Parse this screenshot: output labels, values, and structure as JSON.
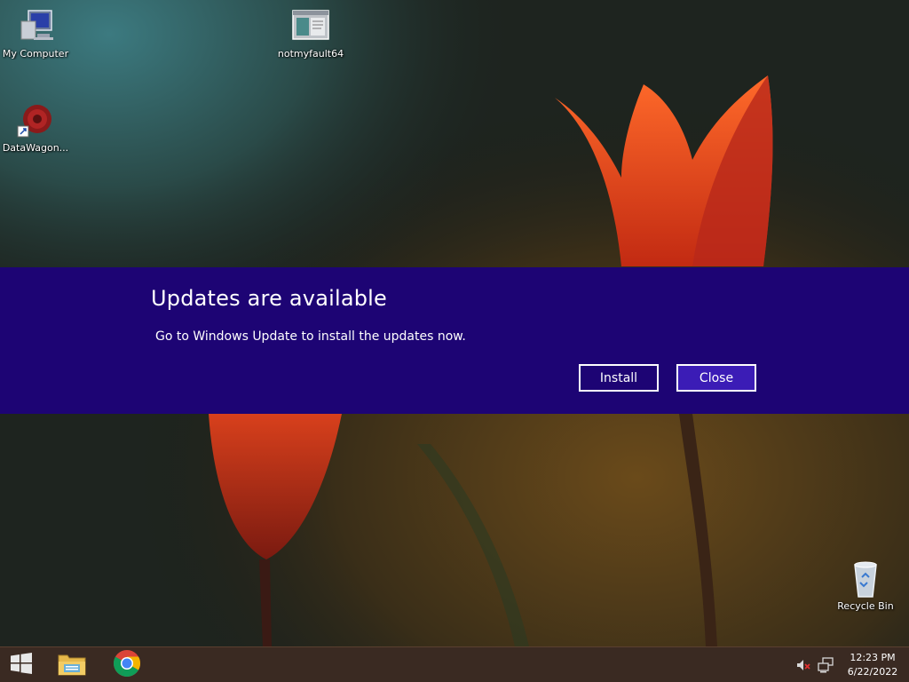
{
  "desktop": {
    "icons": [
      {
        "label": "My Computer",
        "icon": "computer-icon"
      },
      {
        "label": "notmyfault64",
        "icon": "application-window-icon"
      },
      {
        "label": "DataWagon...",
        "icon": "datawagon-shortcut-icon"
      },
      {
        "label": "Recycle Bin",
        "icon": "recycle-bin-icon"
      }
    ]
  },
  "notification": {
    "title": "Updates are available",
    "message": "Go to Windows Update to install the updates now.",
    "install_label": "Install",
    "close_label": "Close",
    "background_color": "#1d0474",
    "accent_button_color": "#3b1cb6"
  },
  "taskbar": {
    "pinned": [
      {
        "name": "start-button",
        "icon": "windows-logo-icon"
      },
      {
        "name": "file-explorer",
        "icon": "folder-icon"
      },
      {
        "name": "chrome",
        "icon": "chrome-icon"
      }
    ],
    "tray": {
      "volume_icon": "speaker-muted-icon",
      "network_icon": "network-icon"
    },
    "clock": {
      "time": "12:23 PM",
      "date": "6/22/2022"
    }
  }
}
